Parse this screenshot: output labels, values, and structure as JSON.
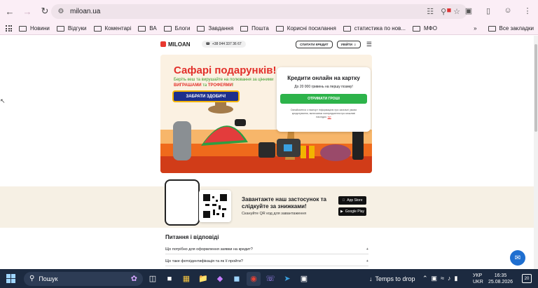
{
  "browser": {
    "url": "miloan.ua",
    "bookmarks": [
      "Новини",
      "Відгуки",
      "Коментарі",
      "ВА",
      "Блоги",
      "Завдання",
      "Пошта",
      "Корисні посилання",
      "статистика по нов...",
      "МФО"
    ],
    "all_bookmarks": "Все закладки"
  },
  "site": {
    "logo": "MILOAN",
    "phone": "+38 044 337 36 67",
    "spyt_label": "СПИТАТИ КРЕДИТ",
    "login_label": "УВІЙТИ"
  },
  "hero": {
    "title": "Сафарі подарунків!",
    "sub_1": "Беріть кеш та вирушайте на полювання за цінними ",
    "sub_2": "ВИГРАШАМИ",
    "sub_3": " та ",
    "sub_4": "ТРОФЕЯМИ",
    "sub_5": "!",
    "cta": "ЗАБРАТИ ЗДОБИЧ!",
    "card_title": "Кредити онлайн на картку",
    "card_sub": "До 20 000 гривень на першу позику!",
    "card_btn": "ОТРИМАТИ ГРОШІ",
    "card_note": "Ознайомтеся з паспорт інформацією про загальні умови кредитування, включаючи попередження про можливі наслідки. ",
    "card_note_link": "тут"
  },
  "app": {
    "title": "Завантажте наш застосунок та слідкуйте за знижками!",
    "sub": "Скануйте QR код для завантаження",
    "appstore_small": "Download on the",
    "appstore": "App Store",
    "gplay_small": "GET IT ON",
    "gplay": "Google Play"
  },
  "faq": {
    "title": "Питання і відповіді",
    "items": [
      "Що потрібно для оформлення заявки на кредит?",
      "Що таке фотоідентифікація та як її пройти?"
    ]
  },
  "taskbar": {
    "search": "Пошук",
    "weather": "Temps to drop",
    "lang_1": "УКР",
    "lang_2": "UKR",
    "time": "16:35",
    "date": "25.08.2026",
    "notifications": "20"
  }
}
